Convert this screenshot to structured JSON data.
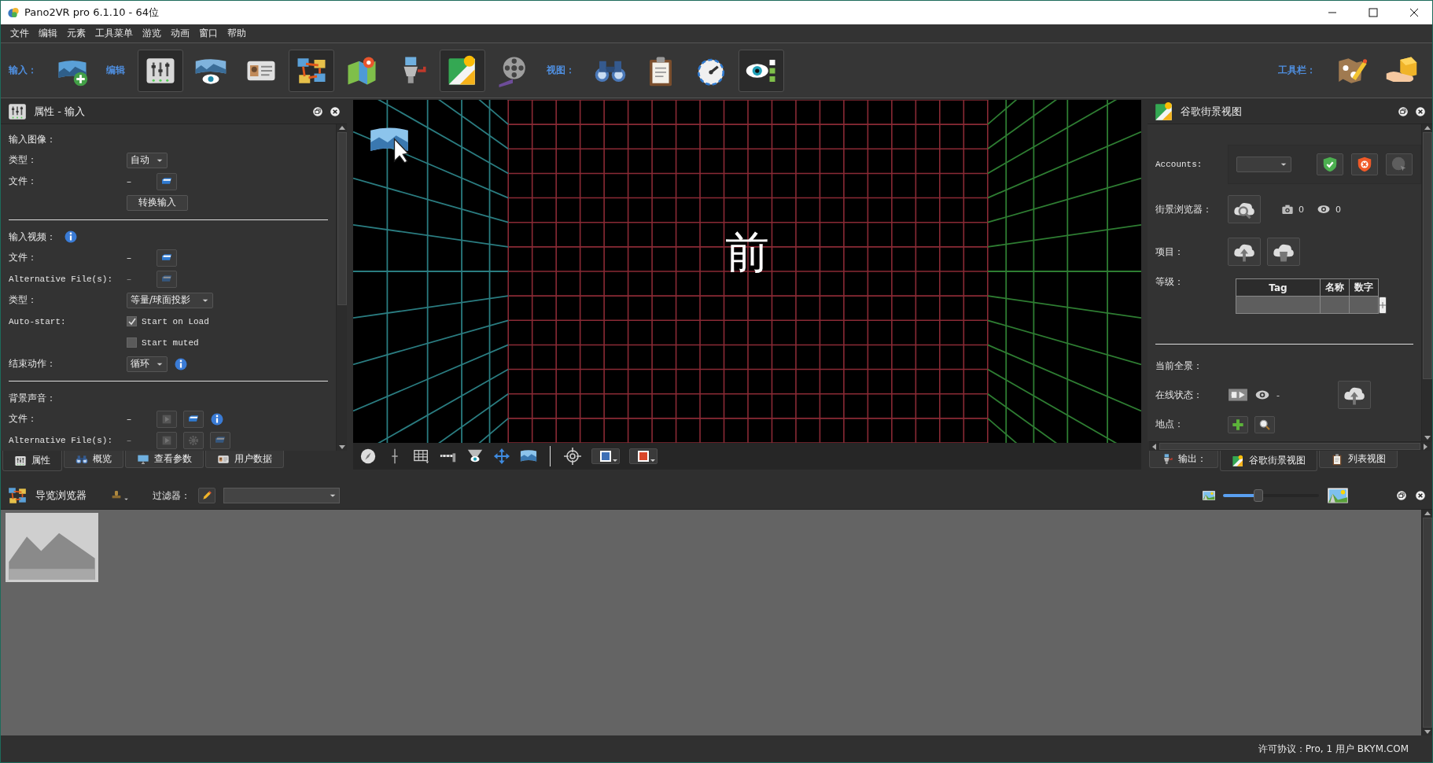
{
  "window": {
    "title": "Pano2VR pro 6.1.10 - 64位"
  },
  "menu": [
    {
      "label": "文件"
    },
    {
      "label": "编辑"
    },
    {
      "label": "元素"
    },
    {
      "label": "工具菜单"
    },
    {
      "label": "游览"
    },
    {
      "label": "动画"
    },
    {
      "label": "窗口"
    },
    {
      "label": "帮助"
    }
  ],
  "toolbar": {
    "groups": [
      {
        "label": "输入：",
        "buttons": [
          {
            "kind": "pano-add",
            "selected": false
          }
        ]
      },
      {
        "label": "编辑",
        "buttons": [
          {
            "kind": "mixer",
            "selected": true
          },
          {
            "kind": "pano-eye",
            "selected": false
          },
          {
            "kind": "id-card",
            "selected": false
          },
          {
            "kind": "tour",
            "selected": true
          },
          {
            "kind": "map-pin",
            "selected": false
          },
          {
            "kind": "grinder",
            "selected": false
          },
          {
            "kind": "street-view",
            "selected": true
          },
          {
            "kind": "film",
            "selected": false
          }
        ]
      },
      {
        "label": "视图：",
        "buttons": [
          {
            "kind": "binoculars",
            "selected": false
          },
          {
            "kind": "clipboard",
            "selected": false
          },
          {
            "kind": "gauge",
            "selected": false
          },
          {
            "kind": "eye-check",
            "selected": true
          }
        ]
      }
    ],
    "end_groups": [
      {
        "label": "工具栏：",
        "buttons": [
          {
            "kind": "map-edit",
            "selected": false
          },
          {
            "kind": "package-hand",
            "selected": false
          }
        ]
      }
    ]
  },
  "properties_panel": {
    "title": "属性 - 输入",
    "sections": [
      {
        "heading": "输入图像：",
        "info": false,
        "rows": [
          {
            "kind": "dropdown",
            "label": "类型：",
            "value": "自动",
            "info": false
          },
          {
            "kind": "file",
            "label": "文件：",
            "value": "–",
            "disabled": false,
            "buttons": [
              {
                "kind": "open",
                "disabled": false
              }
            ],
            "info": false
          },
          {
            "kind": "button",
            "label": "",
            "value": "转换输入"
          }
        ]
      },
      {
        "heading": "输入视频：",
        "info": true,
        "rows": [
          {
            "kind": "file",
            "label": "文件：",
            "value": "–",
            "disabled": false,
            "buttons": [
              {
                "kind": "open",
                "disabled": false
              }
            ],
            "info": false
          },
          {
            "kind": "file",
            "label": "Alternative File(s):",
            "value": "–",
            "disabled": true,
            "buttons": [
              {
                "kind": "open",
                "disabled": true
              }
            ],
            "info": false
          },
          {
            "kind": "dropdown",
            "label": "类型：",
            "value": "等量/球面投影",
            "info": false
          },
          {
            "kind": "checkbox",
            "label": "Auto-start:",
            "value": "Start on Load",
            "checked": true
          },
          {
            "kind": "checkbox",
            "label": "",
            "value": "Start muted",
            "checked": false
          },
          {
            "kind": "dropdown",
            "label": "结束动作：",
            "value": "循环",
            "info": true
          }
        ]
      },
      {
        "heading": "背景声音：",
        "info": false,
        "rows": [
          {
            "kind": "file",
            "label": "文件：",
            "value": "–",
            "disabled": false,
            "buttons": [
              {
                "kind": "play",
                "disabled": true
              },
              {
                "kind": "open",
                "disabled": false
              }
            ],
            "info": true
          },
          {
            "kind": "file",
            "label": "Alternative File(s):",
            "value": "–",
            "disabled": true,
            "buttons": [
              {
                "kind": "play",
                "disabled": true
              },
              {
                "kind": "gear",
                "disabled": true
              },
              {
                "kind": "open",
                "disabled": true
              }
            ],
            "info": false
          }
        ]
      }
    ],
    "tabs": [
      {
        "label": "属性",
        "kind": "mixer",
        "selected": true
      },
      {
        "label": "概览",
        "kind": "binoculars",
        "selected": false
      },
      {
        "label": "查看参数",
        "kind": "monitor",
        "selected": false
      },
      {
        "label": "用户数据",
        "kind": "id-card",
        "selected": false
      }
    ]
  },
  "viewer": {
    "face_label": "前",
    "tools": [
      {
        "kind": "compass"
      },
      {
        "kind": "crosshair"
      },
      {
        "kind": "grid"
      },
      {
        "kind": "barrier"
      },
      {
        "kind": "eye-cone"
      },
      {
        "kind": "move"
      },
      {
        "kind": "pano"
      }
    ],
    "target": {
      "kind": "target"
    },
    "color_buttons": [
      {
        "color": "#3d6fb6"
      },
      {
        "color": "#d9462a"
      }
    ]
  },
  "street_view_panel": {
    "title": "谷歌街景视图",
    "accounts": {
      "label": "Accounts:",
      "buttons": [
        {
          "kind": "shield-check",
          "disabled": false
        },
        {
          "kind": "shield-x",
          "disabled": false
        },
        {
          "kind": "globe-cursor",
          "disabled": true
        }
      ]
    },
    "browser": {
      "label": "街景浏览器：",
      "photos": "0",
      "views": "0"
    },
    "project": {
      "label": "项目："
    },
    "levels": {
      "label": "等级：",
      "columns": [
        "Tag",
        "名称",
        "数字"
      ],
      "rows": [
        {
          "selected": true
        }
      ]
    },
    "current": {
      "heading": "当前全景：",
      "status_label": "在线状态：",
      "status_value": "-",
      "location_label": "地点："
    },
    "tabs": [
      {
        "label": "输出：",
        "kind": "grinder",
        "selected": false
      },
      {
        "label": "谷歌街景视图",
        "kind": "street-view",
        "selected": true
      },
      {
        "label": "列表视图",
        "kind": "clipboard",
        "selected": false
      }
    ]
  },
  "tour_browser": {
    "title": "导览浏览器",
    "filter_label": "过滤器：",
    "zoom": {
      "level": 0.35
    },
    "thumbnails": [
      {
        "selected": false
      }
    ]
  },
  "status_bar": {
    "license": "许可协议：Pro, 1 用户 BKYM.COM"
  }
}
